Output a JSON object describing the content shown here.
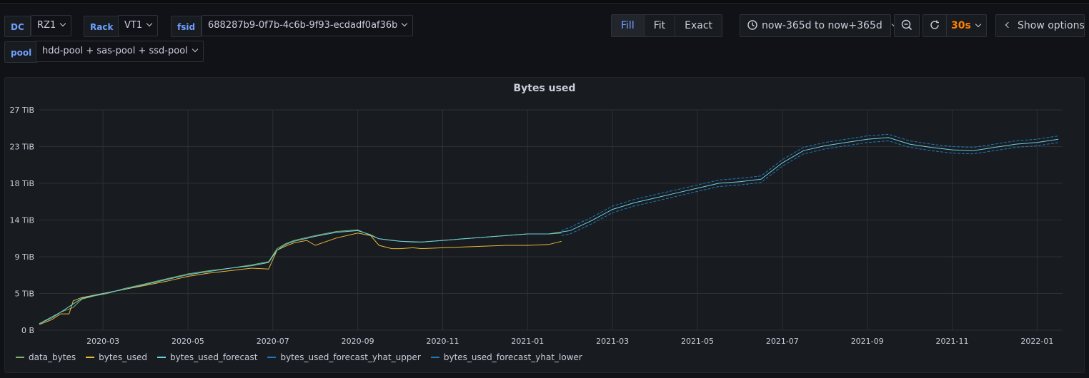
{
  "variables": [
    {
      "label": "DC",
      "value": "RZ1"
    },
    {
      "label": "Rack",
      "value": "VT1"
    },
    {
      "label": "fsid",
      "value": "688287b9-0f7b-4c6b-9f93-ecdadf0af36b"
    },
    {
      "label": "pool",
      "value": "hdd-pool + sas-pool + ssd-pool"
    }
  ],
  "toolbar": {
    "modes": [
      "Fill",
      "Fit",
      "Exact"
    ],
    "active_mode": "Fill",
    "time_range": "now-365d to now+365d",
    "refresh_interval": "30s",
    "show_options": "Show options"
  },
  "colors": {
    "data_bytes": "#7eb26d",
    "bytes_used": "#eab839",
    "bytes_used_forecast": "#6ed0e0",
    "bytes_used_forecast_yhat_upper": "#1f78c1",
    "bytes_used_forecast_yhat_lower": "#1f78c1",
    "accent": "#6e9fff",
    "refresh": "#ff7f00"
  },
  "chart_data": {
    "type": "line",
    "title": "Bytes used",
    "y_ticks": [
      "0 B",
      "5 TiB",
      "9 TiB",
      "14 TiB",
      "18 TiB",
      "23 TiB",
      "27 TiB"
    ],
    "y_tick_values": [
      0,
      4.5,
      9,
      13.5,
      18,
      22.5,
      27
    ],
    "ylim": [
      0,
      27
    ],
    "x_ticks": [
      "2020-03",
      "2020-05",
      "2020-07",
      "2020-09",
      "2020-11",
      "2021-01",
      "2021-03",
      "2021-05",
      "2021-07",
      "2021-09",
      "2021-11",
      "2022-01"
    ],
    "x_tick_values": [
      1.5,
      3.5,
      5.5,
      7.5,
      9.5,
      11.5,
      13.5,
      15.5,
      17.5,
      19.5,
      21.5,
      23.5
    ],
    "xlim": [
      0,
      24.1
    ],
    "grid": true,
    "legend_placement": "bottom-left",
    "series": [
      {
        "name": "data_bytes",
        "x": [
          0,
          0.3,
          0.5,
          0.8,
          1.0,
          1.3,
          1.6,
          2.0,
          2.5,
          3.0,
          3.5,
          4.0,
          4.5,
          5.0,
          5.4,
          5.6,
          5.8,
          6.0,
          6.5,
          7.0,
          7.5,
          7.8,
          8.0,
          8.3,
          8.5,
          8.8,
          9.0,
          9.5,
          10.0,
          10.5,
          11.0,
          11.5,
          12.0,
          12.3
        ],
        "y": [
          0.8,
          1.5,
          2.2,
          2.8,
          3.8,
          4.2,
          4.5,
          5.1,
          5.7,
          6.3,
          6.9,
          7.3,
          7.6,
          8.0,
          8.4,
          10.0,
          10.6,
          11.0,
          11.6,
          12.1,
          12.3,
          11.6,
          11.2,
          11.0,
          10.9,
          10.8,
          10.8,
          11.0,
          11.2,
          11.4,
          11.6,
          11.8,
          11.8,
          11.9
        ]
      },
      {
        "name": "bytes_used",
        "x": [
          0,
          0.3,
          0.5,
          0.7,
          0.8,
          1.0,
          1.3,
          1.6,
          2.0,
          2.5,
          3.0,
          3.5,
          4.0,
          4.5,
          5.0,
          5.4,
          5.6,
          5.8,
          6.0,
          6.3,
          6.5,
          7.0,
          7.5,
          7.8,
          8.0,
          8.3,
          8.5,
          8.8,
          9.0,
          9.5,
          10.0,
          10.5,
          11.0,
          11.5,
          12.0,
          12.3
        ],
        "y": [
          0.7,
          1.3,
          2.0,
          2.0,
          3.6,
          4.0,
          4.3,
          4.6,
          5.0,
          5.5,
          6.0,
          6.6,
          7.0,
          7.3,
          7.6,
          7.5,
          9.8,
          10.3,
          10.7,
          11.0,
          10.4,
          11.3,
          11.9,
          11.6,
          10.4,
          10.0,
          10.0,
          10.1,
          10.0,
          10.1,
          10.2,
          10.3,
          10.4,
          10.4,
          10.5,
          10.9
        ]
      },
      {
        "name": "bytes_used_forecast",
        "x": [
          0,
          0.5,
          1.0,
          1.5,
          2.0,
          2.5,
          3.0,
          3.5,
          4.0,
          4.5,
          5.0,
          5.4,
          5.6,
          5.8,
          6.0,
          6.5,
          7.0,
          7.5,
          7.8,
          8.0,
          8.5,
          9.0,
          9.5,
          10.0,
          10.5,
          11.0,
          11.5,
          12.0,
          12.5,
          13.0,
          13.5,
          14.0,
          14.5,
          15.0,
          15.5,
          16.0,
          16.5,
          17.0,
          17.5,
          18.0,
          18.5,
          19.0,
          19.5,
          20.0,
          20.5,
          21.0,
          21.5,
          22.0,
          22.5,
          23.0,
          23.5,
          24.0
        ],
        "y": [
          0.8,
          2.2,
          3.9,
          4.5,
          5.0,
          5.6,
          6.2,
          6.8,
          7.2,
          7.6,
          7.9,
          8.3,
          9.8,
          10.5,
          10.9,
          11.5,
          12.0,
          12.2,
          11.7,
          11.2,
          10.9,
          10.8,
          11.0,
          11.2,
          11.4,
          11.6,
          11.8,
          11.8,
          12.2,
          13.4,
          14.8,
          15.6,
          16.2,
          16.8,
          17.4,
          18.0,
          18.2,
          18.5,
          20.5,
          22.0,
          22.6,
          23.0,
          23.4,
          23.6,
          22.8,
          22.4,
          22.1,
          22.0,
          22.4,
          22.8,
          23.0,
          23.4
        ]
      },
      {
        "name": "bytes_used_forecast_yhat_upper",
        "x": [
          12.3,
          12.5,
          13.0,
          13.5,
          14.0,
          14.5,
          15.0,
          15.5,
          16.0,
          16.5,
          17.0,
          17.5,
          18.0,
          18.5,
          19.0,
          19.5,
          20.0,
          20.5,
          21.0,
          21.5,
          22.0,
          22.5,
          23.0,
          23.5,
          24.0
        ],
        "y": [
          12.2,
          12.6,
          13.8,
          15.2,
          16.0,
          16.6,
          17.2,
          17.8,
          18.4,
          18.6,
          18.9,
          20.9,
          22.4,
          23.0,
          23.4,
          23.8,
          24.0,
          23.2,
          22.8,
          22.5,
          22.4,
          22.8,
          23.2,
          23.4,
          23.8
        ]
      },
      {
        "name": "bytes_used_forecast_yhat_lower",
        "x": [
          12.3,
          12.5,
          13.0,
          13.5,
          14.0,
          14.5,
          15.0,
          15.5,
          16.0,
          16.5,
          17.0,
          17.5,
          18.0,
          18.5,
          19.0,
          19.5,
          20.0,
          20.5,
          21.0,
          21.5,
          22.0,
          22.5,
          23.0,
          23.5,
          24.0
        ],
        "y": [
          11.6,
          11.8,
          13.0,
          14.4,
          15.2,
          15.8,
          16.4,
          17.0,
          17.6,
          17.8,
          18.1,
          20.1,
          21.6,
          22.2,
          22.6,
          23.0,
          23.2,
          22.4,
          22.0,
          21.7,
          21.6,
          22.0,
          22.4,
          22.6,
          23.0
        ]
      }
    ]
  }
}
